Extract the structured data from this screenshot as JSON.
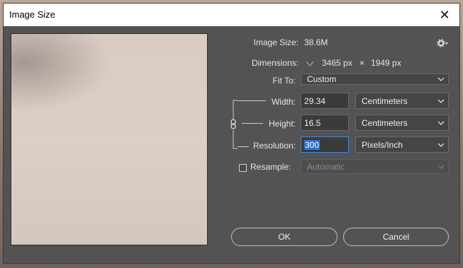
{
  "window": {
    "title": "Image Size",
    "close_glyph": "✕"
  },
  "image_size": {
    "label": "Image Size:",
    "value": "38.6M"
  },
  "settings_icon": "gear-icon",
  "dimensions": {
    "label": "Dimensions:",
    "width": "3465 px",
    "sep": "×",
    "height": "1949 px"
  },
  "fit_to": {
    "label": "Fit To:",
    "value": "Custom"
  },
  "width": {
    "label": "Width:",
    "value": "29.34",
    "unit": "Centimeters"
  },
  "height": {
    "label": "Height:",
    "value": "16.5",
    "unit": "Centimeters"
  },
  "resolution": {
    "label": "Resolution:",
    "value": "300",
    "unit": "Pixels/Inch"
  },
  "resample": {
    "label": "Resample:",
    "checked": false,
    "value": "Automatic"
  },
  "buttons": {
    "ok": "OK",
    "cancel": "Cancel"
  },
  "colors": {
    "dialog_bg": "#535353",
    "focus_ring": "#3f86d9",
    "selection": "#2f6fd0"
  }
}
